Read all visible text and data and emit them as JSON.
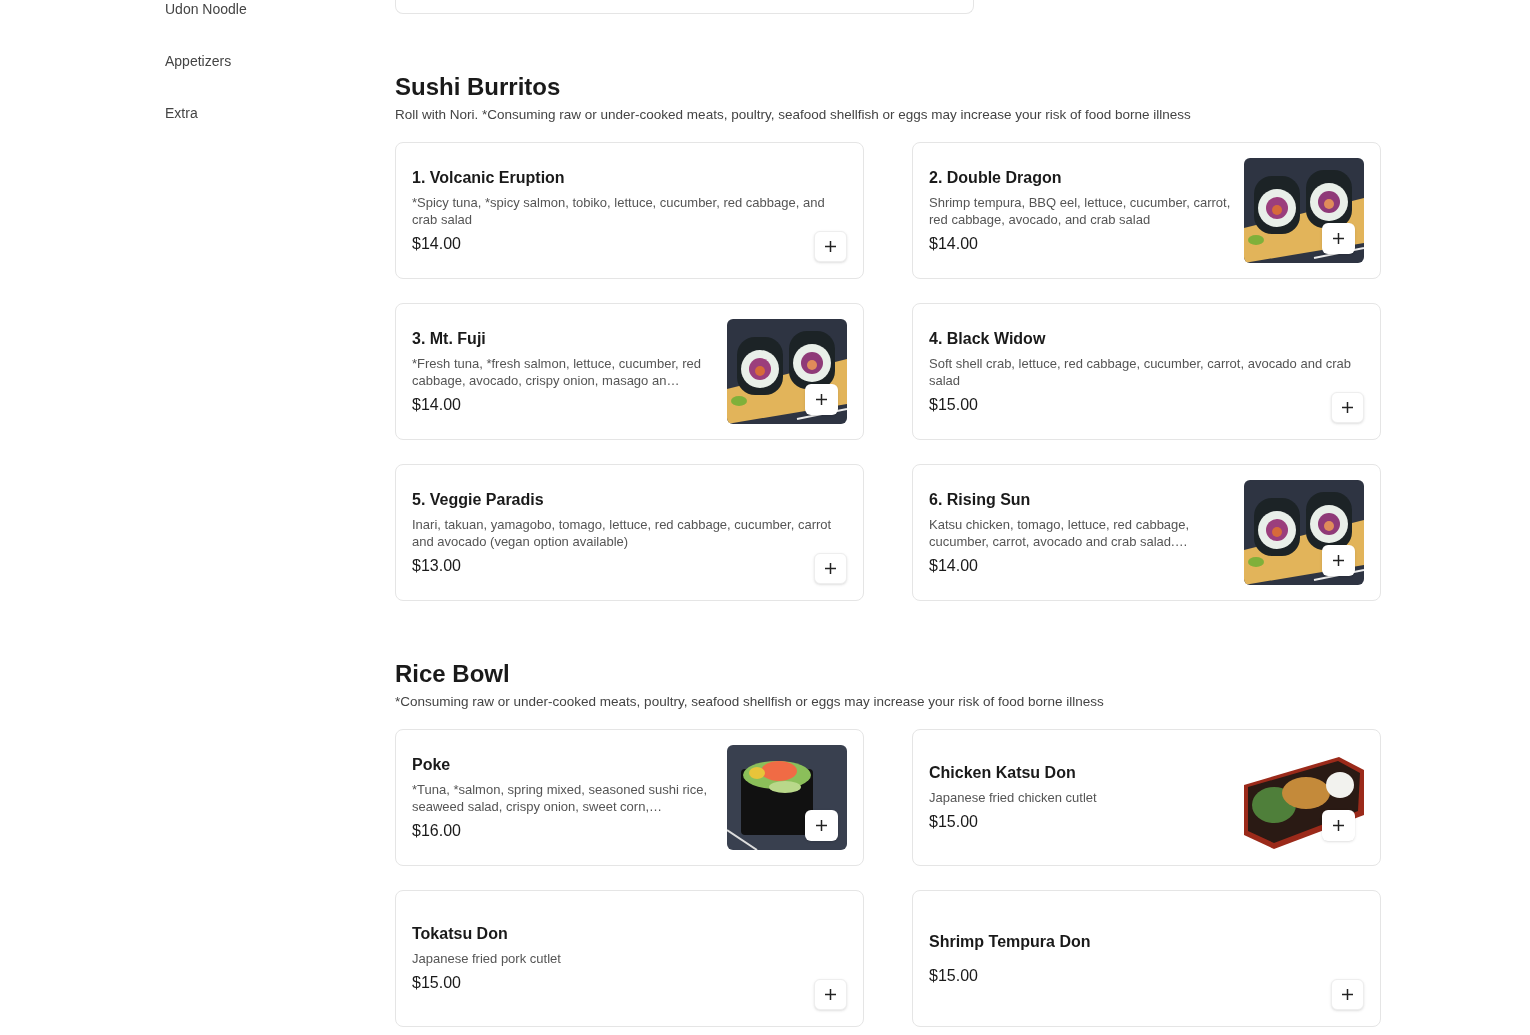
{
  "sidebar": {
    "items": [
      {
        "label": "Udon Noodle"
      },
      {
        "label": "Appetizers"
      },
      {
        "label": "Extra"
      }
    ]
  },
  "sections": [
    {
      "title": "Sushi Burritos",
      "note": "Roll with Nori. *Consuming raw or under-cooked meats, poultry, seafood shellfish or eggs may increase your risk of food borne illness",
      "items": [
        {
          "name": "1. Volcanic Eruption",
          "description": "*Spicy tuna, *spicy salmon, tobiko, lettuce, cucumber, red cabbage, and crab salad",
          "price": "$14.00"
        },
        {
          "name": "2. Double Dragon",
          "description": "Shrimp tempura, BBQ eel, lettuce, cucumber, carrot, red cabbage, avocado, and crab salad",
          "price": "$14.00"
        },
        {
          "name": "3. Mt. Fuji",
          "description": "*Fresh tuna, *fresh salmon, lettuce, cucumber, red cabbage, avocado, crispy onion, masago an…",
          "price": "$14.00"
        },
        {
          "name": "4. Black Widow",
          "description": "Soft shell crab, lettuce, red cabbage, cucumber, carrot, avocado and crab salad",
          "price": "$15.00"
        },
        {
          "name": "5. Veggie Paradis",
          "description": "Inari, takuan, yamagobo, tomago, lettuce, red cabbage, cucumber, carrot and avocado (vegan option available)",
          "price": "$13.00"
        },
        {
          "name": "6. Rising Sun",
          "description": "Katsu chicken, tomago, lettuce, red cabbage, cucumber, carrot, avocado and crab salad.…",
          "price": "$14.00"
        }
      ]
    },
    {
      "title": "Rice Bowl",
      "note": "*Consuming raw or under-cooked meats, poultry, seafood shellfish or eggs may increase your risk of food borne illness",
      "items": [
        {
          "name": "Poke",
          "description": "*Tuna, *salmon, spring mixed, seasoned sushi rice, seaweed salad, crispy onion, sweet corn,…",
          "price": "$16.00"
        },
        {
          "name": "Chicken Katsu Don",
          "description": "Japanese fried chicken cutlet",
          "price": "$15.00"
        },
        {
          "name": "Tokatsu Don",
          "description": "Japanese fried pork cutlet",
          "price": "$15.00"
        },
        {
          "name": "Shrimp Tempura Don",
          "price": "$15.00"
        }
      ]
    }
  ]
}
